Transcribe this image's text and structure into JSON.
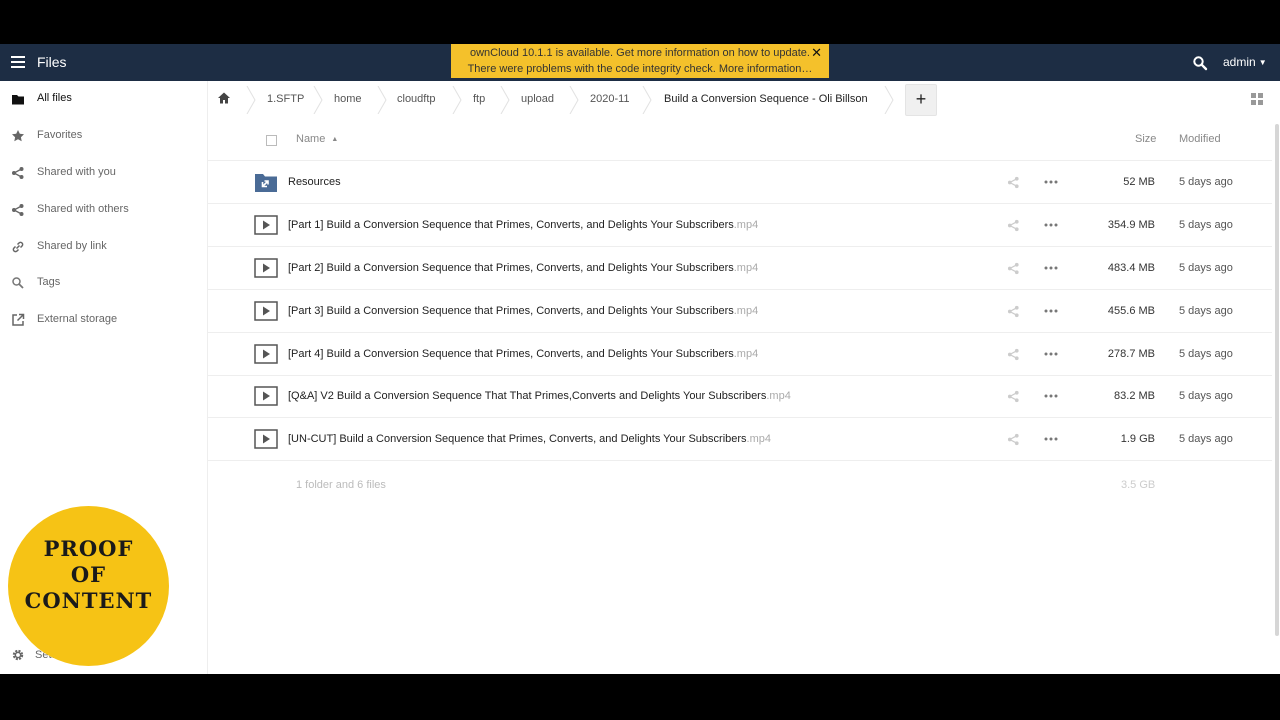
{
  "header": {
    "app_name": "Files",
    "user": "admin"
  },
  "notification": {
    "line1": "ownCloud 10.1.1 is available. Get more information on how to update.",
    "line2": "There were problems with the code integrity check. More information…",
    "close_symbol": "✕"
  },
  "sidebar": {
    "items": [
      {
        "label": "All files",
        "icon": "folder-icon"
      },
      {
        "label": "Favorites",
        "icon": "star-icon"
      },
      {
        "label": "Shared with you",
        "icon": "share-icon"
      },
      {
        "label": "Shared with others",
        "icon": "share-icon"
      },
      {
        "label": "Shared by link",
        "icon": "link-icon"
      },
      {
        "label": "Tags",
        "icon": "search-icon"
      },
      {
        "label": "External storage",
        "icon": "external-link-icon"
      }
    ],
    "settings_label": "Sett"
  },
  "breadcrumb": [
    "1.SFTP",
    "home",
    "cloudftp",
    "ftp",
    "upload",
    "2020-11",
    "Build a Conversion Sequence - Oli Billson"
  ],
  "new_button": "+",
  "table": {
    "columns": {
      "name": "Name",
      "size": "Size",
      "modified": "Modified"
    },
    "rows": [
      {
        "name": "Resources",
        "ext": "",
        "type": "folder",
        "size": "52 MB",
        "modified": "5 days ago"
      },
      {
        "name": "[Part 1] Build a Conversion Sequence that Primes, Converts, and Delights Your Subscribers",
        "ext": ".mp4",
        "type": "video",
        "size": "354.9 MB",
        "modified": "5 days ago"
      },
      {
        "name": "[Part 2] Build a Conversion Sequence that Primes, Converts, and Delights Your Subscribers",
        "ext": ".mp4",
        "type": "video",
        "size": "483.4 MB",
        "modified": "5 days ago"
      },
      {
        "name": "[Part 3] Build a Conversion Sequence that Primes, Converts, and Delights Your Subscribers",
        "ext": ".mp4",
        "type": "video",
        "size": "455.6 MB",
        "modified": "5 days ago"
      },
      {
        "name": "[Part 4] Build a Conversion Sequence that Primes, Converts, and Delights Your Subscribers",
        "ext": ".mp4",
        "type": "video",
        "size": "278.7 MB",
        "modified": "5 days ago"
      },
      {
        "name": "[Q&A] V2 Build a Conversion Sequence That That Primes,Converts and Delights Your Subscribers",
        "ext": ".mp4",
        "type": "video",
        "size": "83.2 MB",
        "modified": "5 days ago"
      },
      {
        "name": "[UN-CUT] Build a Conversion Sequence that Primes, Converts, and Delights Your Subscribers",
        "ext": ".mp4",
        "type": "video",
        "size": "1.9 GB",
        "modified": "5 days ago"
      }
    ],
    "summary": "1 folder and 6 files",
    "total_size": "3.5 GB"
  },
  "badge": {
    "line1": "PROOF",
    "line2": "OF",
    "line3": "CONTENT"
  },
  "colors": {
    "header_bg": "#1d2d44",
    "notice_bg": "#f4c12b",
    "badge_bg": "#f6c315",
    "folder_blue": "#4a6b96"
  }
}
